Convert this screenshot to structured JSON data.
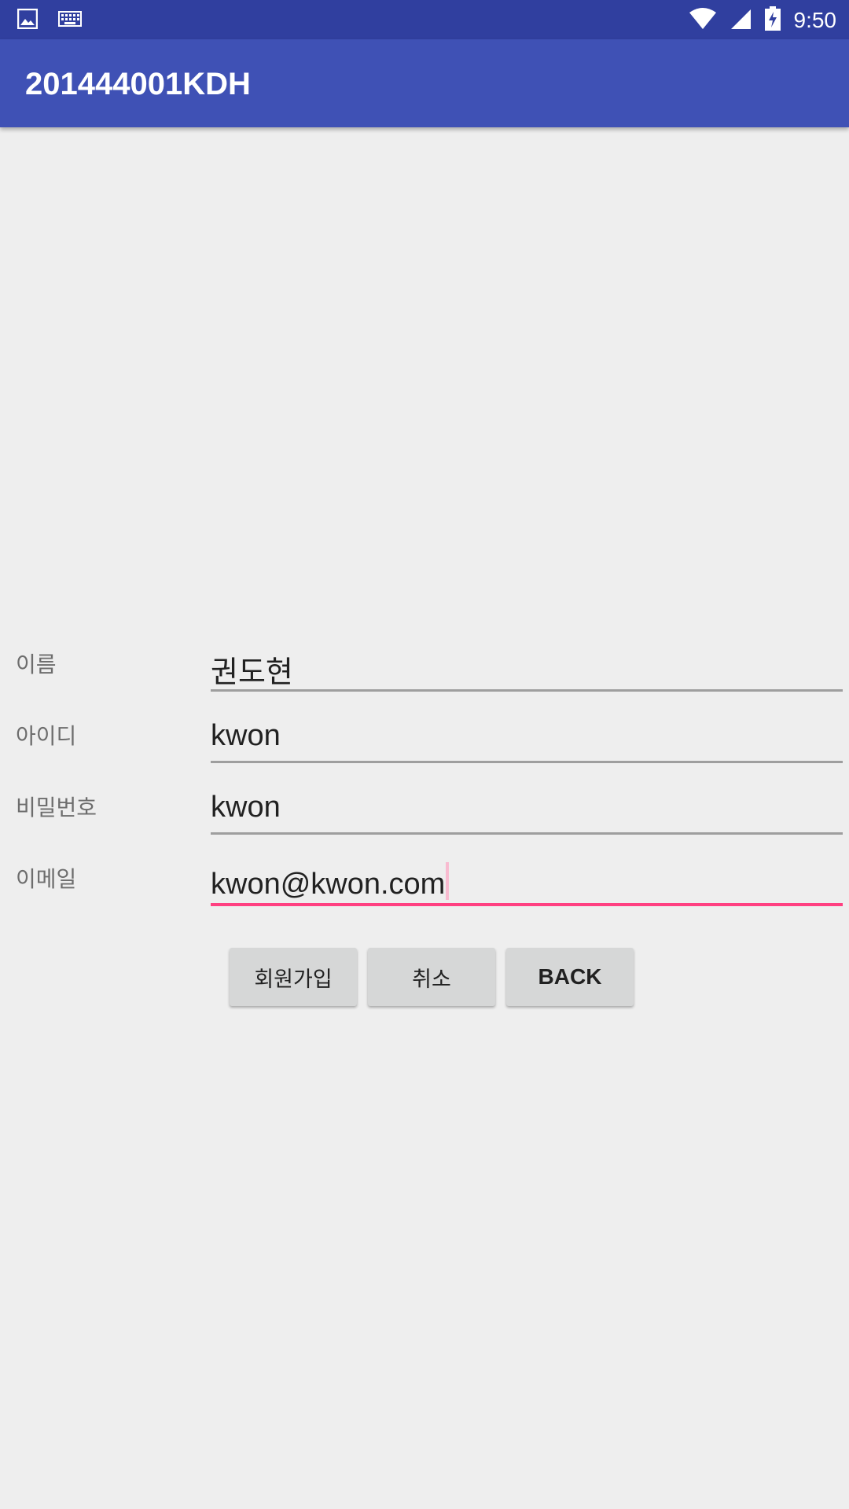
{
  "status_bar": {
    "left_icons": [
      "gallery-icon",
      "keyboard-icon"
    ],
    "right_icons": [
      "wifi-icon",
      "cellular-signal-icon",
      "battery-charging-icon"
    ],
    "time": "9:50"
  },
  "app_bar": {
    "title": "201444001KDH"
  },
  "form": {
    "fields": [
      {
        "label": "이름",
        "value": "권도현"
      },
      {
        "label": "아이디",
        "value": "kwon"
      },
      {
        "label": "비밀번호",
        "value": "kwon"
      },
      {
        "label": "이메일",
        "value": "kwon@kwon.com"
      }
    ],
    "focused_field": "이메일"
  },
  "buttons": {
    "signup": "회원가입",
    "cancel": "취소",
    "back": "BACK"
  },
  "colors": {
    "status_bar": "#303f9f",
    "app_bar": "#3f51b5",
    "accent": "#ff4081",
    "background": "#eeeeee"
  }
}
